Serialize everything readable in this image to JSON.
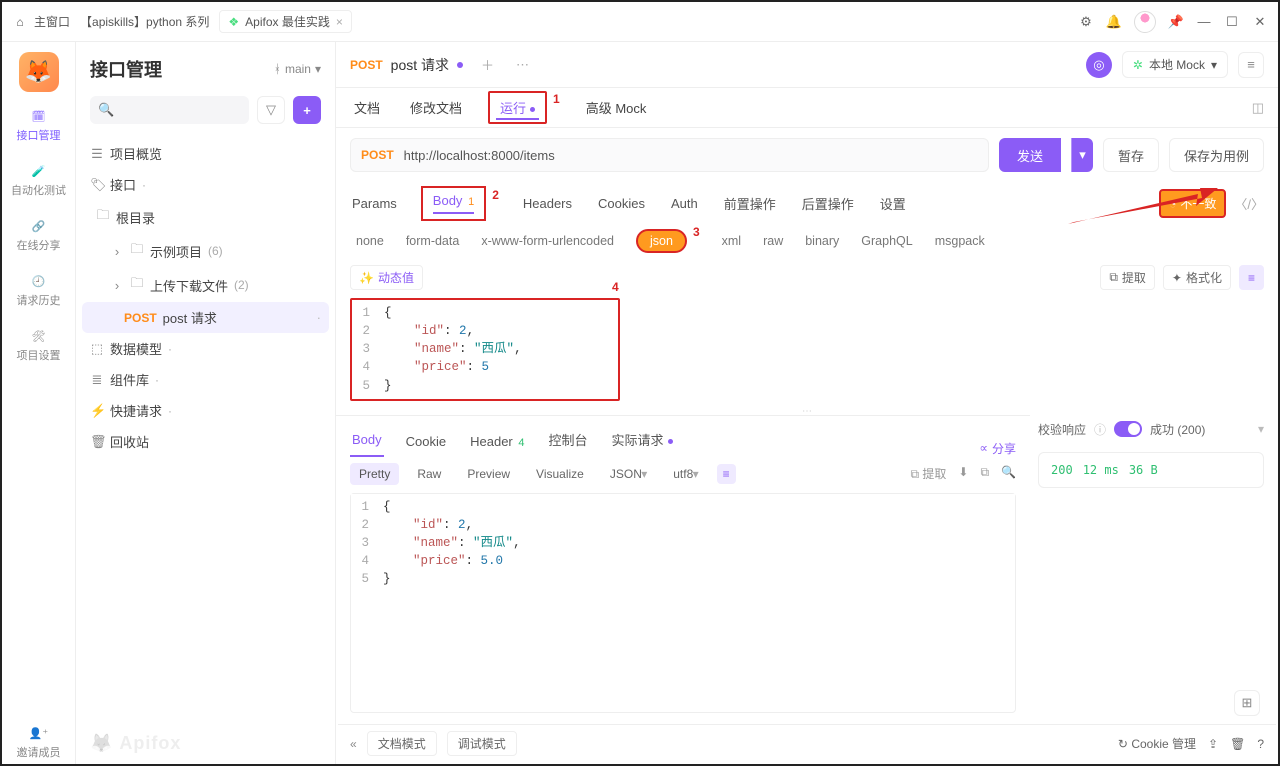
{
  "window": {
    "home": "主窗口",
    "breadcrumb": "【apiskills】python 系列",
    "tab": "Apifox 最佳实践"
  },
  "rail": {
    "items": [
      {
        "label": "接口管理",
        "active": true
      },
      {
        "label": "自动化测试",
        "active": false
      },
      {
        "label": "在线分享",
        "active": false
      },
      {
        "label": "请求历史",
        "active": false
      },
      {
        "label": "项目设置",
        "active": false
      }
    ],
    "invite": "邀请成员"
  },
  "sidebar": {
    "title": "接口管理",
    "branch": "main",
    "search_placeholder": "Q",
    "tree": {
      "overview": "项目概览",
      "api_root": "接口",
      "root_dir": "根目录",
      "folders": [
        {
          "name": "示例项目",
          "count": "(6)"
        },
        {
          "name": "上传下载文件",
          "count": "(2)"
        }
      ],
      "active_item": {
        "method": "POST",
        "name": "post 请求"
      },
      "data_models": "数据模型",
      "components": "组件库",
      "quick_request": "快捷请求",
      "recycle": "回收站"
    },
    "watermark": "Apifox"
  },
  "tabbar": {
    "method": "POST",
    "title": "post 请求",
    "env": "本地 Mock"
  },
  "subtabs": {
    "doc": "文档",
    "edit_doc": "修改文档",
    "run": "运行",
    "adv_mock": "高级 Mock"
  },
  "annotations": {
    "a1": "1",
    "a2": "2",
    "a3": "3",
    "a4": "4"
  },
  "request": {
    "method": "POST",
    "url": "http://localhost:8000/items",
    "send": "发送",
    "save_draft": "暂存",
    "save_case": "保存为用例",
    "tabs": {
      "params": "Params",
      "body": "Body",
      "body_count": "1",
      "headers": "Headers",
      "cookies": "Cookies",
      "auth": "Auth",
      "pre": "前置操作",
      "post": "后置操作",
      "settings": "设置"
    },
    "diff_badge": "不一致",
    "body_types": {
      "none": "none",
      "form": "form-data",
      "xform": "x-www-form-urlencoded",
      "json": "json",
      "xml": "xml",
      "raw": "raw",
      "binary": "binary",
      "graphql": "GraphQL",
      "msgpack": "msgpack"
    },
    "toolbar": {
      "dynamic": "动态值",
      "extract": "提取",
      "format": "格式化"
    },
    "body_json": {
      "l1": "{",
      "l2a": "\"id\"",
      "l2b": "2",
      "l3a": "\"name\"",
      "l3b": "\"西瓜\"",
      "l4a": "\"price\"",
      "l4b": "5",
      "l5": "}"
    }
  },
  "response": {
    "tabs": {
      "body": "Body",
      "cookie": "Cookie",
      "header": "Header",
      "header_count": "4",
      "console": "控制台",
      "actual": "实际请求"
    },
    "share": "分享",
    "subtabs": {
      "pretty": "Pretty",
      "raw": "Raw",
      "preview": "Preview",
      "visualize": "Visualize",
      "json": "JSON",
      "utf8": "utf8",
      "extract": "提取"
    },
    "body_json": {
      "l1": "{",
      "l2a": "\"id\"",
      "l2b": "2",
      "l3a": "\"name\"",
      "l3b": "\"西瓜\"",
      "l4a": "\"price\"",
      "l4b": "5.0",
      "l5": "}"
    },
    "validation": {
      "label": "校验响应",
      "success": "成功 (200)",
      "status_code": "200",
      "time": "12 ms",
      "size": "36 B"
    }
  },
  "bottombar": {
    "doc_mode": "文档模式",
    "debug_mode": "调试模式",
    "cookie": "Cookie 管理"
  }
}
